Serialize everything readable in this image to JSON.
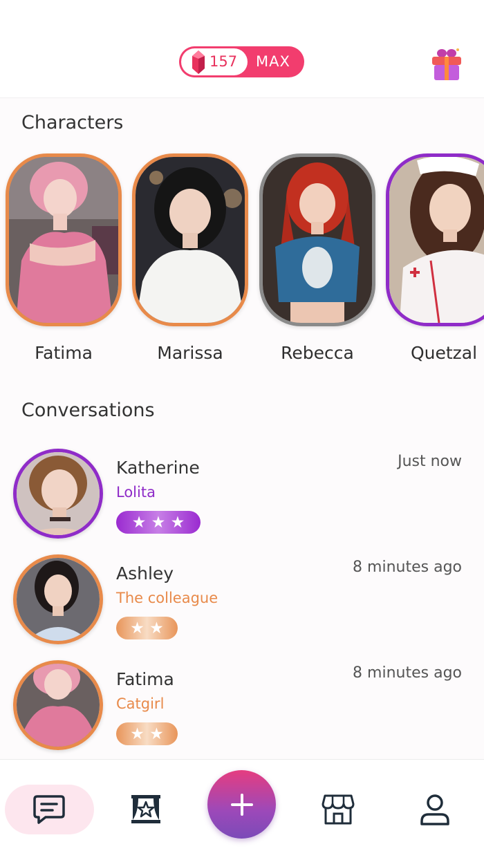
{
  "header": {
    "gem_count": "157",
    "max_label": "MAX",
    "gift_icon": "gift-icon"
  },
  "sections": {
    "characters_title": "Characters",
    "conversations_title": "Conversations"
  },
  "characters": [
    {
      "name": "Fatima",
      "frame": "orange"
    },
    {
      "name": "Marissa",
      "frame": "orange"
    },
    {
      "name": "Rebecca",
      "frame": "gray"
    },
    {
      "name": "Quetzal",
      "frame": "purple"
    }
  ],
  "conversations": [
    {
      "name": "Katherine",
      "role": "Lolita",
      "time": "Just now",
      "stars": 3,
      "stars_text": "★ ★ ★",
      "tier": "purple"
    },
    {
      "name": "Ashley",
      "role": "The colleague",
      "time": "8 minutes ago",
      "stars": 2,
      "stars_text": "★ ★",
      "tier": "orange"
    },
    {
      "name": "Fatima",
      "role": "Catgirl",
      "time": "8 minutes ago",
      "stars": 2,
      "stars_text": "★ ★",
      "tier": "orange"
    }
  ],
  "nav": {
    "fab_label": "+",
    "items": [
      "chat-icon",
      "stage-icon",
      "store-icon",
      "profile-icon"
    ],
    "active": "chat-icon"
  },
  "colors": {
    "accent_pink": "#f23d6e",
    "tier_orange": "#e88a4a",
    "tier_purple": "#8f2cc8",
    "tier_gray": "#8a8a8a"
  }
}
